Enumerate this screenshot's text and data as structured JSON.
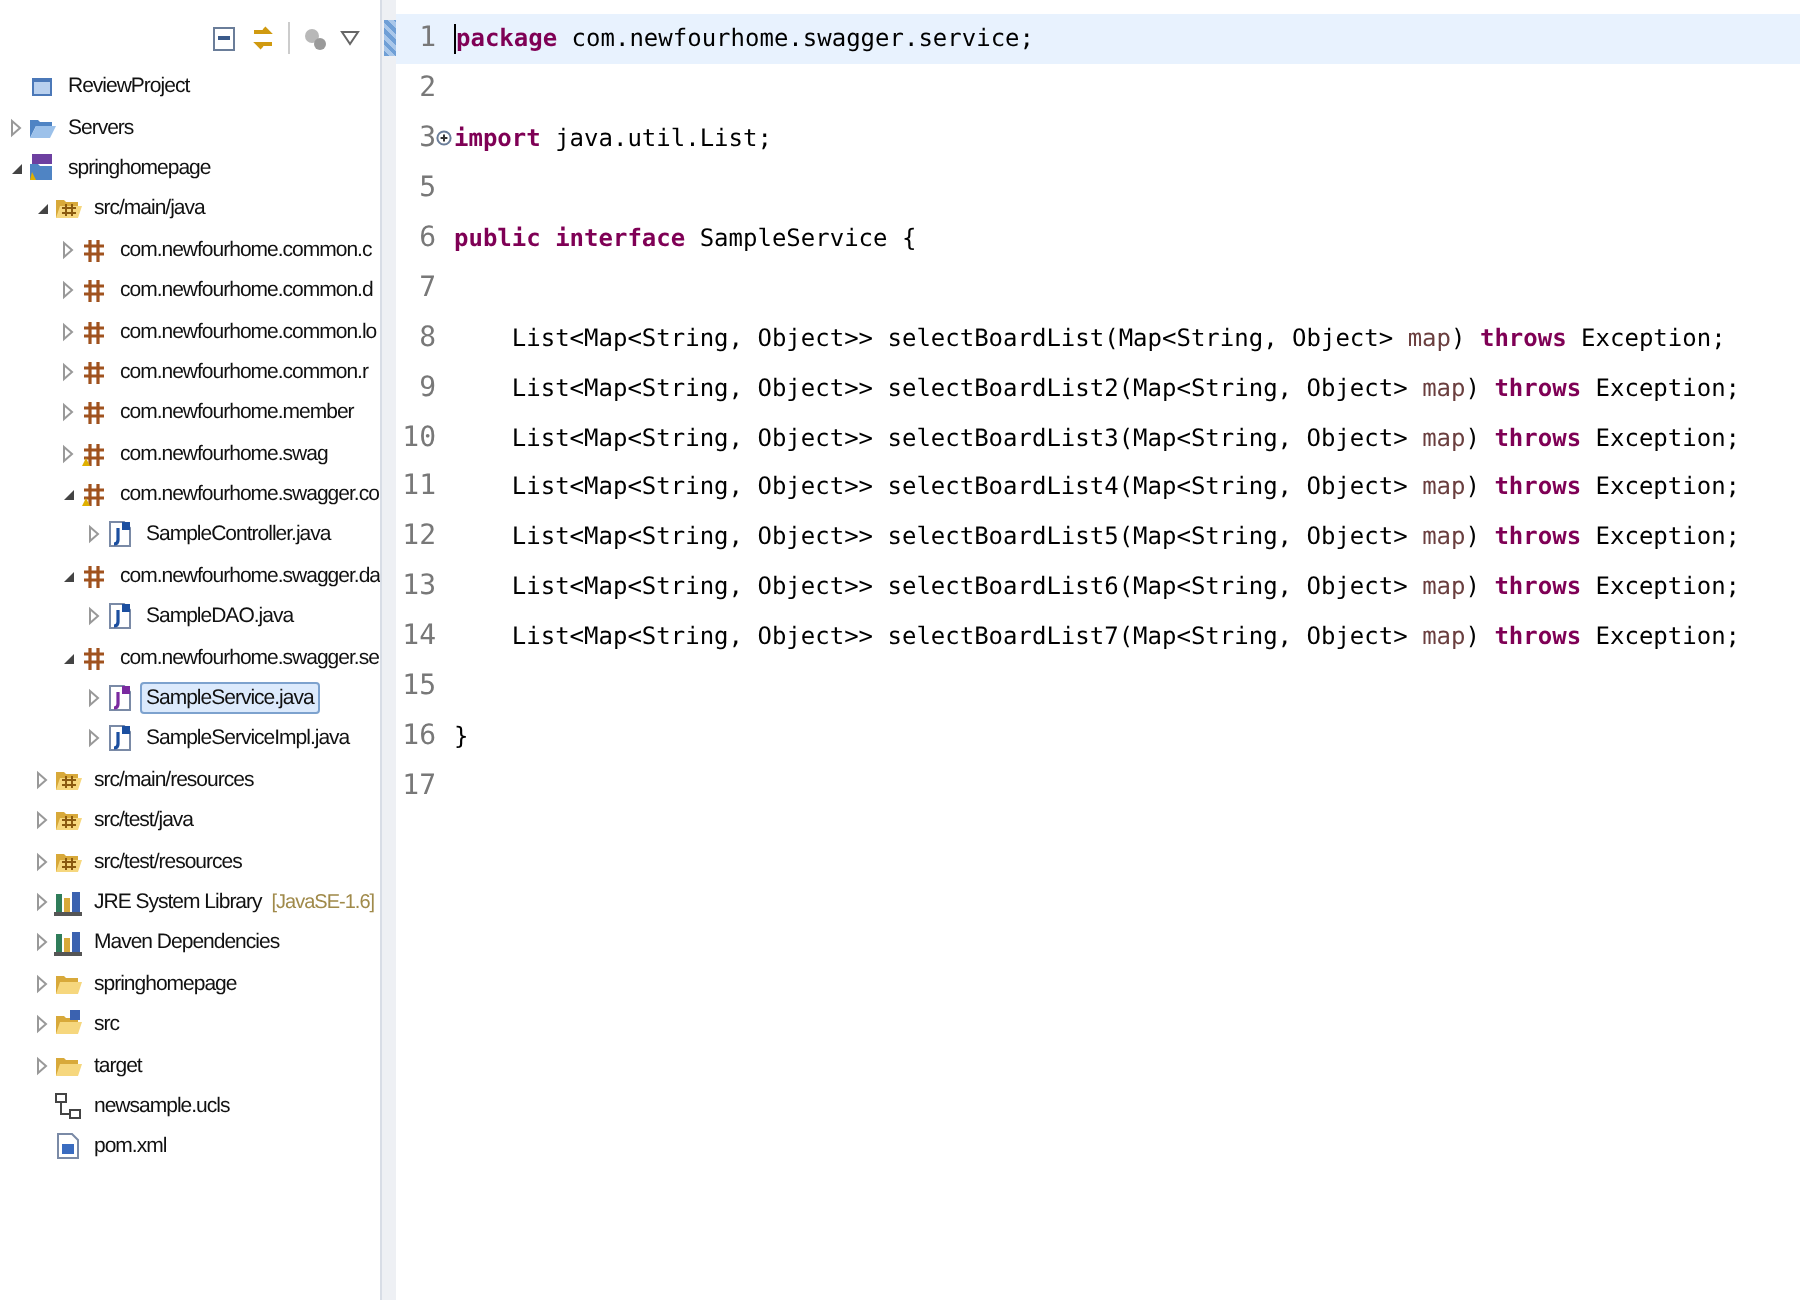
{
  "explorer": {
    "items": [
      {
        "label": "ReviewProject",
        "kind": "project",
        "selected": false
      },
      {
        "label": "Servers",
        "kind": "folder-open",
        "expanded": false,
        "selected": false
      },
      {
        "label": "springhomepage",
        "kind": "maven-project",
        "expanded": true,
        "selected": false,
        "children": [
          {
            "label": "src/main/java",
            "kind": "source-folder",
            "expanded": true,
            "selected": false,
            "children": [
              {
                "label": "com.newfourhome.common.c",
                "kind": "package",
                "expanded": false,
                "selected": false
              },
              {
                "label": "com.newfourhome.common.d",
                "kind": "package",
                "expanded": false,
                "selected": false
              },
              {
                "label": "com.newfourhome.common.lo",
                "kind": "package",
                "expanded": false,
                "selected": false
              },
              {
                "label": "com.newfourhome.common.r",
                "kind": "package",
                "expanded": false,
                "selected": false
              },
              {
                "label": "com.newfourhome.member",
                "kind": "package",
                "expanded": false,
                "selected": false
              },
              {
                "label": "com.newfourhome.swag",
                "kind": "package-warn",
                "expanded": false,
                "selected": false
              },
              {
                "label": "com.newfourhome.swagger.co",
                "kind": "package-warn",
                "expanded": true,
                "selected": false,
                "children": [
                  {
                    "label": "SampleController.java",
                    "kind": "java-class",
                    "expanded": false,
                    "selected": false
                  }
                ]
              },
              {
                "label": "com.newfourhome.swagger.da",
                "kind": "package",
                "expanded": true,
                "selected": false,
                "children": [
                  {
                    "label": "SampleDAO.java",
                    "kind": "java-class",
                    "expanded": false,
                    "selected": false
                  }
                ]
              },
              {
                "label": "com.newfourhome.swagger.se",
                "kind": "package",
                "expanded": true,
                "selected": false,
                "children": [
                  {
                    "label": "SampleService.java",
                    "kind": "java-interface",
                    "expanded": false,
                    "selected": true
                  },
                  {
                    "label": "SampleServiceImpl.java",
                    "kind": "java-class",
                    "expanded": false,
                    "selected": false
                  }
                ]
              }
            ]
          },
          {
            "label": "src/main/resources",
            "kind": "source-folder",
            "expanded": false,
            "selected": false
          },
          {
            "label": "src/test/java",
            "kind": "source-folder",
            "expanded": false,
            "selected": false
          },
          {
            "label": "src/test/resources",
            "kind": "source-folder",
            "expanded": false,
            "selected": false
          },
          {
            "label": "JRE System Library",
            "decoration": "[JavaSE-1.6]",
            "kind": "library",
            "expanded": false,
            "selected": false
          },
          {
            "label": "Maven Dependencies",
            "kind": "library",
            "expanded": false,
            "selected": false
          },
          {
            "label": "springhomepage",
            "kind": "folder",
            "expanded": false,
            "selected": false
          },
          {
            "label": "src",
            "kind": "java-folder",
            "expanded": false,
            "selected": false
          },
          {
            "label": "target",
            "kind": "folder",
            "expanded": false,
            "selected": false
          },
          {
            "label": "newsample.ucls",
            "kind": "diagram",
            "selected": false
          },
          {
            "label": "pom.xml",
            "kind": "xml",
            "selected": false
          }
        ]
      }
    ]
  },
  "editor": {
    "lines": [
      {
        "number": "1",
        "current": true,
        "tokens": [
          {
            "kind": "keyword",
            "text": "package"
          },
          {
            "kind": "plain",
            "text": " com.newfourhome.swagger.service;"
          }
        ]
      },
      {
        "number": "2",
        "current": false
      },
      {
        "number": "3",
        "current": false,
        "folded": true,
        "tokens": [
          {
            "kind": "keyword",
            "text": "import"
          },
          {
            "kind": "plain",
            "text": " java.util.List;"
          }
        ]
      },
      {
        "number": "5",
        "current": false
      },
      {
        "number": "6",
        "current": false,
        "tokens": [
          {
            "kind": "keyword",
            "text": "public interface"
          },
          {
            "kind": "plain",
            "text": " SampleService {"
          }
        ]
      },
      {
        "number": "7",
        "current": false
      },
      {
        "number": "8",
        "current": false,
        "tokens": [
          {
            "kind": "plain",
            "text": "    List<Map<String, Object>> selectBoardList(Map<String, Object> "
          },
          {
            "kind": "param",
            "text": "map"
          },
          {
            "kind": "plain",
            "text": ") "
          },
          {
            "kind": "keyword",
            "text": "throws"
          },
          {
            "kind": "plain",
            "text": " Exception;"
          }
        ]
      },
      {
        "number": "9",
        "current": false,
        "tokens": [
          {
            "kind": "plain",
            "text": "    List<Map<String, Object>> selectBoardList2(Map<String, Object> "
          },
          {
            "kind": "param",
            "text": "map"
          },
          {
            "kind": "plain",
            "text": ") "
          },
          {
            "kind": "keyword",
            "text": "throws"
          },
          {
            "kind": "plain",
            "text": " Exception;"
          }
        ]
      },
      {
        "number": "10",
        "current": false,
        "tokens": [
          {
            "kind": "plain",
            "text": "    List<Map<String, Object>> selectBoardList3(Map<String, Object> "
          },
          {
            "kind": "param",
            "text": "map"
          },
          {
            "kind": "plain",
            "text": ") "
          },
          {
            "kind": "keyword",
            "text": "throws"
          },
          {
            "kind": "plain",
            "text": " Exception;"
          }
        ]
      },
      {
        "number": "11",
        "current": false,
        "tokens": [
          {
            "kind": "plain",
            "text": "    List<Map<String, Object>> selectBoardList4(Map<String, Object> "
          },
          {
            "kind": "param",
            "text": "map"
          },
          {
            "kind": "plain",
            "text": ") "
          },
          {
            "kind": "keyword",
            "text": "throws"
          },
          {
            "kind": "plain",
            "text": " Exception;"
          }
        ]
      },
      {
        "number": "12",
        "current": false,
        "tokens": [
          {
            "kind": "plain",
            "text": "    List<Map<String, Object>> selectBoardList5(Map<String, Object> "
          },
          {
            "kind": "param",
            "text": "map"
          },
          {
            "kind": "plain",
            "text": ") "
          },
          {
            "kind": "keyword",
            "text": "throws"
          },
          {
            "kind": "plain",
            "text": " Exception;"
          }
        ]
      },
      {
        "number": "13",
        "current": false,
        "tokens": [
          {
            "kind": "plain",
            "text": "    List<Map<String, Object>> selectBoardList6(Map<String, Object> "
          },
          {
            "kind": "param",
            "text": "map"
          },
          {
            "kind": "plain",
            "text": ") "
          },
          {
            "kind": "keyword",
            "text": "throws"
          },
          {
            "kind": "plain",
            "text": " Exception;"
          }
        ]
      },
      {
        "number": "14",
        "current": false,
        "tokens": [
          {
            "kind": "plain",
            "text": "    List<Map<String, Object>> selectBoardList7(Map<String, Object> "
          },
          {
            "kind": "param",
            "text": "map"
          },
          {
            "kind": "plain",
            "text": ") "
          },
          {
            "kind": "keyword",
            "text": "throws"
          },
          {
            "kind": "plain",
            "text": " Exception;"
          }
        ]
      },
      {
        "number": "15",
        "current": false
      },
      {
        "number": "16",
        "current": false,
        "tokens": [
          {
            "kind": "plain",
            "text": "}"
          }
        ]
      },
      {
        "number": "17",
        "current": false
      }
    ]
  }
}
